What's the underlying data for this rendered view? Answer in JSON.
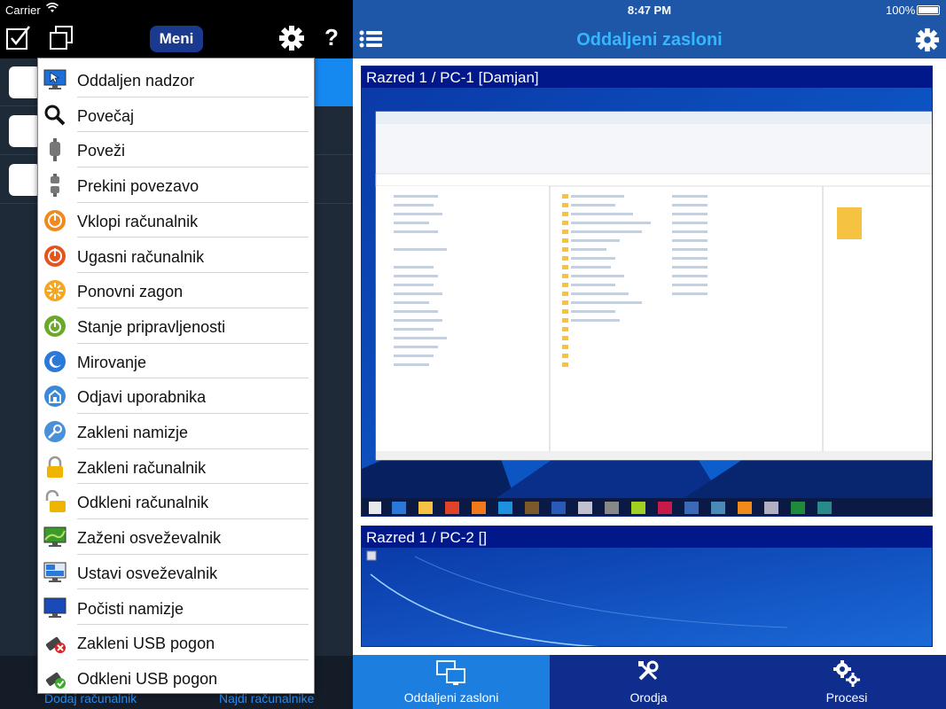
{
  "status_left": {
    "carrier": "Carrier"
  },
  "status_right": {
    "time": "8:47 PM",
    "battery": "100%"
  },
  "left_toolbar": {
    "menu_label": "Meni",
    "help_label": "?"
  },
  "left_bottom": {
    "add_computer": "Dodaj računalnik",
    "find_computers": "Najdi računalnike"
  },
  "menu": {
    "items": [
      {
        "label": "Oddaljen nadzor",
        "icon": "monitor-cursor-icon"
      },
      {
        "label": "Povečaj",
        "icon": "magnifier-icon"
      },
      {
        "label": "Poveži",
        "icon": "plug-connect-icon"
      },
      {
        "label": "Prekini povezavo",
        "icon": "plug-disconnect-icon"
      },
      {
        "label": "Vklopi računalnik",
        "icon": "power-on-icon"
      },
      {
        "label": "Ugasni računalnik",
        "icon": "power-off-icon"
      },
      {
        "label": "Ponovni zagon",
        "icon": "restart-icon"
      },
      {
        "label": "Stanje pripravljenosti",
        "icon": "standby-icon"
      },
      {
        "label": "Mirovanje",
        "icon": "hibernate-icon"
      },
      {
        "label": "Odjavi uporabnika",
        "icon": "logoff-icon"
      },
      {
        "label": "Zakleni namizje",
        "icon": "lock-desktop-icon"
      },
      {
        "label": "Zakleni računalnik",
        "icon": "padlock-closed-icon"
      },
      {
        "label": "Odkleni računalnik",
        "icon": "padlock-open-icon"
      },
      {
        "label": "Zaženi osveževalnik",
        "icon": "screensaver-start-icon"
      },
      {
        "label": "Ustavi osveževalnik",
        "icon": "screensaver-stop-icon"
      },
      {
        "label": "Počisti namizje",
        "icon": "clear-desktop-icon"
      },
      {
        "label": "Zakleni USB pogon",
        "icon": "usb-lock-icon"
      },
      {
        "label": "Odkleni USB pogon",
        "icon": "usb-unlock-icon"
      }
    ]
  },
  "right": {
    "title": "Oddaljeni zasloni",
    "screens": [
      {
        "caption": "Razred 1 / PC-1 [Damjan]"
      },
      {
        "caption": "Razred 1 / PC-2 []"
      }
    ]
  },
  "tabs": [
    {
      "label": "Oddaljeni zasloni",
      "icon": "monitors-icon",
      "active": true
    },
    {
      "label": "Orodja",
      "icon": "tools-icon",
      "active": false
    },
    {
      "label": "Procesi",
      "icon": "gears-icon",
      "active": false
    }
  ],
  "colors": {
    "header_blue": "#1f57a8",
    "title_cyan": "#35b6ff",
    "tabbar": "#0f2d8c",
    "tab_active": "#1c7fe0",
    "screen_caption_bg": "#00188a"
  }
}
